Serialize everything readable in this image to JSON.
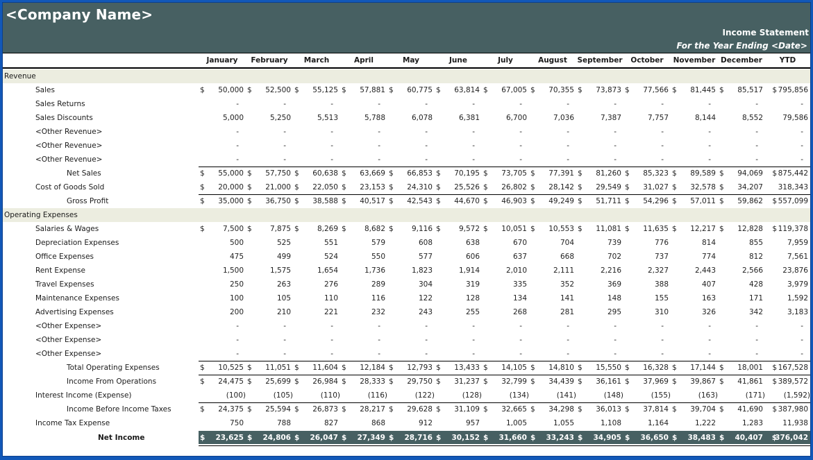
{
  "header": {
    "company_name": "<Company Name>",
    "statement_title": "Income Statement",
    "period": "For the Year Ending <Date>"
  },
  "columns": [
    "January",
    "February",
    "March",
    "April",
    "May",
    "June",
    "July",
    "August",
    "September",
    "October",
    "November",
    "December",
    "YTD"
  ],
  "rows": [
    {
      "label": "Revenue",
      "level": 0,
      "type": "section",
      "values": []
    },
    {
      "label": "Sales",
      "level": 1,
      "dollar": true,
      "values": [
        "50,000",
        "52,500",
        "55,125",
        "57,881",
        "60,775",
        "63,814",
        "67,005",
        "70,355",
        "73,873",
        "77,566",
        "81,445",
        "85,517",
        "795,856"
      ]
    },
    {
      "label": "Sales Returns",
      "level": 1,
      "values": [
        "-",
        "-",
        "-",
        "-",
        "-",
        "-",
        "-",
        "-",
        "-",
        "-",
        "-",
        "-",
        "-"
      ]
    },
    {
      "label": "Sales Discounts",
      "level": 1,
      "values": [
        "5,000",
        "5,250",
        "5,513",
        "5,788",
        "6,078",
        "6,381",
        "6,700",
        "7,036",
        "7,387",
        "7,757",
        "8,144",
        "8,552",
        "79,586"
      ]
    },
    {
      "label": "<Other Revenue>",
      "level": 1,
      "values": [
        "-",
        "-",
        "-",
        "-",
        "-",
        "-",
        "-",
        "-",
        "-",
        "-",
        "-",
        "-",
        "-"
      ]
    },
    {
      "label": "<Other Revenue>",
      "level": 1,
      "values": [
        "-",
        "-",
        "-",
        "-",
        "-",
        "-",
        "-",
        "-",
        "-",
        "-",
        "-",
        "-",
        "-"
      ]
    },
    {
      "label": "<Other Revenue>",
      "level": 1,
      "values": [
        "-",
        "-",
        "-",
        "-",
        "-",
        "-",
        "-",
        "-",
        "-",
        "-",
        "-",
        "-",
        "-"
      ]
    },
    {
      "label": "Net Sales",
      "level": 2,
      "dollar": true,
      "topline": true,
      "values": [
        "55,000",
        "57,750",
        "60,638",
        "63,669",
        "66,853",
        "70,195",
        "73,705",
        "77,391",
        "81,260",
        "85,323",
        "89,589",
        "94,069",
        "875,442"
      ]
    },
    {
      "label": "Cost of Goods Sold",
      "level": 1,
      "dollar": true,
      "ytd_no_dollar": true,
      "values": [
        "20,000",
        "21,000",
        "22,050",
        "23,153",
        "24,310",
        "25,526",
        "26,802",
        "28,142",
        "29,549",
        "31,027",
        "32,578",
        "34,207",
        "318,343"
      ]
    },
    {
      "label": "Gross Profit",
      "level": 2,
      "dollar": true,
      "topline": true,
      "values": [
        "35,000",
        "36,750",
        "38,588",
        "40,517",
        "42,543",
        "44,670",
        "46,903",
        "49,249",
        "51,711",
        "54,296",
        "57,011",
        "59,862",
        "557,099"
      ]
    },
    {
      "label": "Operating Expenses",
      "level": 0,
      "type": "section",
      "values": []
    },
    {
      "label": "Salaries & Wages",
      "level": 1,
      "dollar": true,
      "values": [
        "7,500",
        "7,875",
        "8,269",
        "8,682",
        "9,116",
        "9,572",
        "10,051",
        "10,553",
        "11,081",
        "11,635",
        "12,217",
        "12,828",
        "119,378"
      ]
    },
    {
      "label": "Depreciation Expenses",
      "level": 1,
      "values": [
        "500",
        "525",
        "551",
        "579",
        "608",
        "638",
        "670",
        "704",
        "739",
        "776",
        "814",
        "855",
        "7,959"
      ]
    },
    {
      "label": "Office Expenses",
      "level": 1,
      "values": [
        "475",
        "499",
        "524",
        "550",
        "577",
        "606",
        "637",
        "668",
        "702",
        "737",
        "774",
        "812",
        "7,561"
      ]
    },
    {
      "label": "Rent Expense",
      "level": 1,
      "values": [
        "1,500",
        "1,575",
        "1,654",
        "1,736",
        "1,823",
        "1,914",
        "2,010",
        "2,111",
        "2,216",
        "2,327",
        "2,443",
        "2,566",
        "23,876"
      ]
    },
    {
      "label": "Travel Expenses",
      "level": 1,
      "values": [
        "250",
        "263",
        "276",
        "289",
        "304",
        "319",
        "335",
        "352",
        "369",
        "388",
        "407",
        "428",
        "3,979"
      ]
    },
    {
      "label": "Maintenance Expenses",
      "level": 1,
      "values": [
        "100",
        "105",
        "110",
        "116",
        "122",
        "128",
        "134",
        "141",
        "148",
        "155",
        "163",
        "171",
        "1,592"
      ]
    },
    {
      "label": "Advertising Expenses",
      "level": 1,
      "values": [
        "200",
        "210",
        "221",
        "232",
        "243",
        "255",
        "268",
        "281",
        "295",
        "310",
        "326",
        "342",
        "3,183"
      ]
    },
    {
      "label": "<Other Expense>",
      "level": 1,
      "values": [
        "-",
        "-",
        "-",
        "-",
        "-",
        "-",
        "-",
        "-",
        "-",
        "-",
        "-",
        "-",
        "-"
      ]
    },
    {
      "label": "<Other Expense>",
      "level": 1,
      "values": [
        "-",
        "-",
        "-",
        "-",
        "-",
        "-",
        "-",
        "-",
        "-",
        "-",
        "-",
        "-",
        "-"
      ]
    },
    {
      "label": "<Other Expense>",
      "level": 1,
      "values": [
        "-",
        "-",
        "-",
        "-",
        "-",
        "-",
        "-",
        "-",
        "-",
        "-",
        "-",
        "-",
        "-"
      ]
    },
    {
      "label": "Total Operating Expenses",
      "level": 2,
      "dollar": true,
      "topline": true,
      "values": [
        "10,525",
        "11,051",
        "11,604",
        "12,184",
        "12,793",
        "13,433",
        "14,105",
        "14,810",
        "15,550",
        "16,328",
        "17,144",
        "18,001",
        "167,528"
      ]
    },
    {
      "label": "Income From Operations",
      "level": 2,
      "dollar": true,
      "topline": true,
      "values": [
        "24,475",
        "25,699",
        "26,984",
        "28,333",
        "29,750",
        "31,237",
        "32,799",
        "34,439",
        "36,161",
        "37,969",
        "39,867",
        "41,861",
        "389,572"
      ]
    },
    {
      "label": "Interest Income (Expense)",
      "level": 1,
      "values": [
        "(100)",
        "(105)",
        "(110)",
        "(116)",
        "(122)",
        "(128)",
        "(134)",
        "(141)",
        "(148)",
        "(155)",
        "(163)",
        "(171)",
        "(1,592)"
      ]
    },
    {
      "label": "Income Before Income Taxes",
      "level": 2,
      "dollar": true,
      "topline": true,
      "values": [
        "24,375",
        "25,594",
        "26,873",
        "28,217",
        "29,628",
        "31,109",
        "32,665",
        "34,298",
        "36,013",
        "37,814",
        "39,704",
        "41,690",
        "387,980"
      ]
    },
    {
      "label": "Income Tax Expense",
      "level": 1,
      "values": [
        "750",
        "788",
        "827",
        "868",
        "912",
        "957",
        "1,005",
        "1,055",
        "1,108",
        "1,164",
        "1,222",
        "1,283",
        "11,938"
      ]
    },
    {
      "label": "Net Income",
      "level": 3,
      "type": "net",
      "dollar": true,
      "values": [
        "23,625",
        "24,806",
        "26,047",
        "27,349",
        "28,716",
        "30,152",
        "31,660",
        "33,243",
        "34,905",
        "36,650",
        "38,483",
        "40,407",
        "376,042"
      ]
    }
  ],
  "colors": {
    "banner": "#476062",
    "section_fill": "#ecede0",
    "frame_border": "#1258b8"
  }
}
